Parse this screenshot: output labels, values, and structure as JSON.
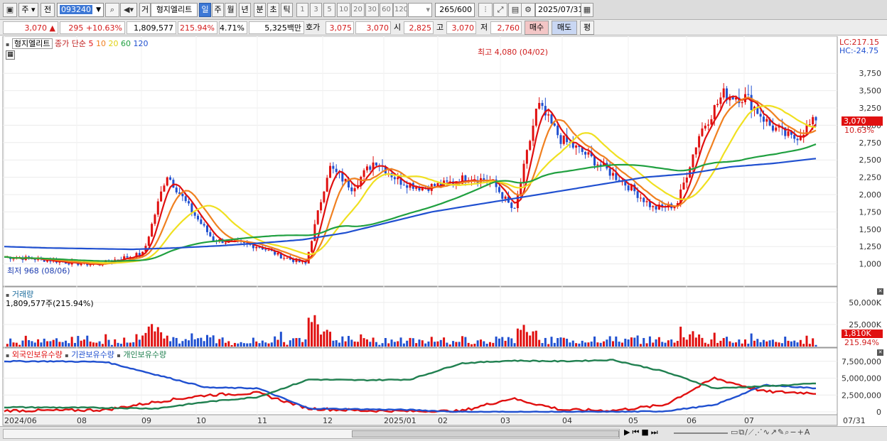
{
  "toolbar": {
    "type": "주",
    "prev": "전",
    "code": "093240",
    "mode": "거",
    "name": "형지엘리트",
    "periods": [
      "일",
      "주",
      "월",
      "년",
      "분",
      "초",
      "틱"
    ],
    "minutes": [
      "1",
      "3",
      "5",
      "10",
      "20",
      "30",
      "60",
      "120"
    ],
    "count": "265",
    "count_total": "/600",
    "date": "2025/07/31"
  },
  "quote": {
    "price": "3,070 ▲",
    "change": "295 +10.63%",
    "volume": "1,809,577",
    "vol_ratio": "215.94%",
    "turnover": "4.71%",
    "amount": "5,325백만",
    "hoga_label": "호가",
    "hoga1": "3,075",
    "hoga2": "3,070",
    "open_label": "시",
    "open": "2,825",
    "high_label": "고",
    "high": "3,070",
    "low_label": "저",
    "low": "2,760",
    "buy": "매수",
    "sell": "매도",
    "eval": "평"
  },
  "price_panel": {
    "title": "형지엘리트",
    "ma_label": "종가 단순",
    "ma_periods": [
      "5",
      "10",
      "20",
      "60",
      "120"
    ],
    "ma_colors": [
      "#e01010",
      "#f08020",
      "#f0e020",
      "#20a040",
      "#2050d0"
    ],
    "lc": "LC:217.15",
    "hc": "HC:-24.75",
    "max_label": "최고 4,080 (04/02)",
    "min_label": "최저 968 (08/06)",
    "last_price": "3,070",
    "last_change": "10.63%",
    "y_ticks": [
      "3,750",
      "3,500",
      "3,250",
      "3,000",
      "2,750",
      "2,500",
      "2,250",
      "2,000",
      "1,750",
      "1,500",
      "1,250",
      "1,000"
    ]
  },
  "volume_panel": {
    "title": "거래량",
    "value": "1,809,577주(215.94%)",
    "y_ticks": [
      "50,000K",
      "25,000K"
    ],
    "last_vol": "1,810K",
    "last_pct": "215.94%"
  },
  "holding_panel": {
    "legend": [
      "외국인보유수량",
      "기관보유수량",
      "개인보유수량"
    ],
    "colors": [
      "#e01010",
      "#2050d0",
      "#208050"
    ],
    "y_ticks": [
      "7,500,000",
      "5,000,000",
      "2,500,000",
      "0"
    ]
  },
  "x_axis": [
    "2024/06",
    "08",
    "09",
    "10",
    "11",
    "12",
    "2025/01",
    "02",
    "03",
    "04",
    "05",
    "06",
    "07",
    "07/31"
  ],
  "chart_data": {
    "type": "line",
    "ylim": [
      750,
      4080
    ],
    "max_price": 4080,
    "min_price": 968,
    "last_close": 3070,
    "close_trend": [
      1100,
      1080,
      1050,
      1010,
      990,
      1080,
      1150,
      2300,
      1800,
      1350,
      1300,
      1250,
      1100,
      1000,
      2400,
      2100,
      2500,
      2200,
      2100,
      2150,
      2250,
      2200,
      1750,
      3300,
      2800,
      2600,
      2350,
      2100,
      1800,
      1850,
      2900,
      3450,
      3400,
      3000,
      2800,
      3070
    ],
    "ma120_trend": [
      1250,
      1230,
      1220,
      1210,
      1230,
      1260,
      1300,
      1350,
      1450,
      1600,
      1750,
      1850,
      1950,
      2050,
      2150,
      2250,
      2300,
      2400,
      2450,
      2520
    ],
    "volume_max_K": 58000
  }
}
